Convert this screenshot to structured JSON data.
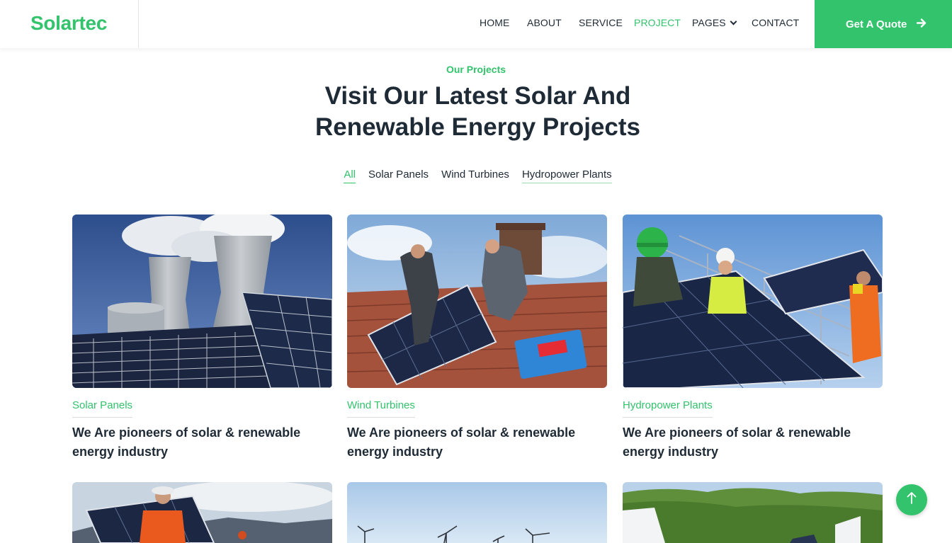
{
  "brand": {
    "name": "Solartec",
    "accent": "#32c36c"
  },
  "nav": {
    "items": [
      {
        "label": "HOME",
        "active": false
      },
      {
        "label": "ABOUT",
        "active": false
      },
      {
        "label": "SERVICE",
        "active": false
      },
      {
        "label": "PROJECT",
        "active": true
      },
      {
        "label": "PAGES",
        "active": false,
        "dropdown": true
      },
      {
        "label": "CONTACT",
        "active": false
      }
    ],
    "cta_label": "Get A Quote",
    "cta_icon": "arrow-right-icon"
  },
  "section": {
    "subtitle": "Our Projects",
    "title_line1": "Visit Our Latest Solar And",
    "title_line2": "Renewable Energy Projects"
  },
  "filters": [
    {
      "label": "All",
      "active": true
    },
    {
      "label": "Solar Panels",
      "active": false
    },
    {
      "label": "Wind Turbines",
      "active": false
    },
    {
      "label": "Hydropower Plants",
      "active": false
    }
  ],
  "projects": [
    {
      "category": "Solar Panels",
      "title": "We Are pioneers of solar & renewable energy industry",
      "image": "cooling-towers-and-solar-panels"
    },
    {
      "category": "Wind Turbines",
      "title": "We Are pioneers of solar & renewable energy industry",
      "image": "workers-installing-roof-panels"
    },
    {
      "category": "Hydropower Plants",
      "title": "We Are pioneers of solar & renewable energy industry",
      "image": "workers-carrying-solar-panels"
    },
    {
      "image": "worker-with-panel-and-hills"
    },
    {
      "image": "wind-turbines-sky"
    },
    {
      "image": "solar-field-with-trees"
    }
  ],
  "back_to_top_icon": "arrow-up-icon"
}
